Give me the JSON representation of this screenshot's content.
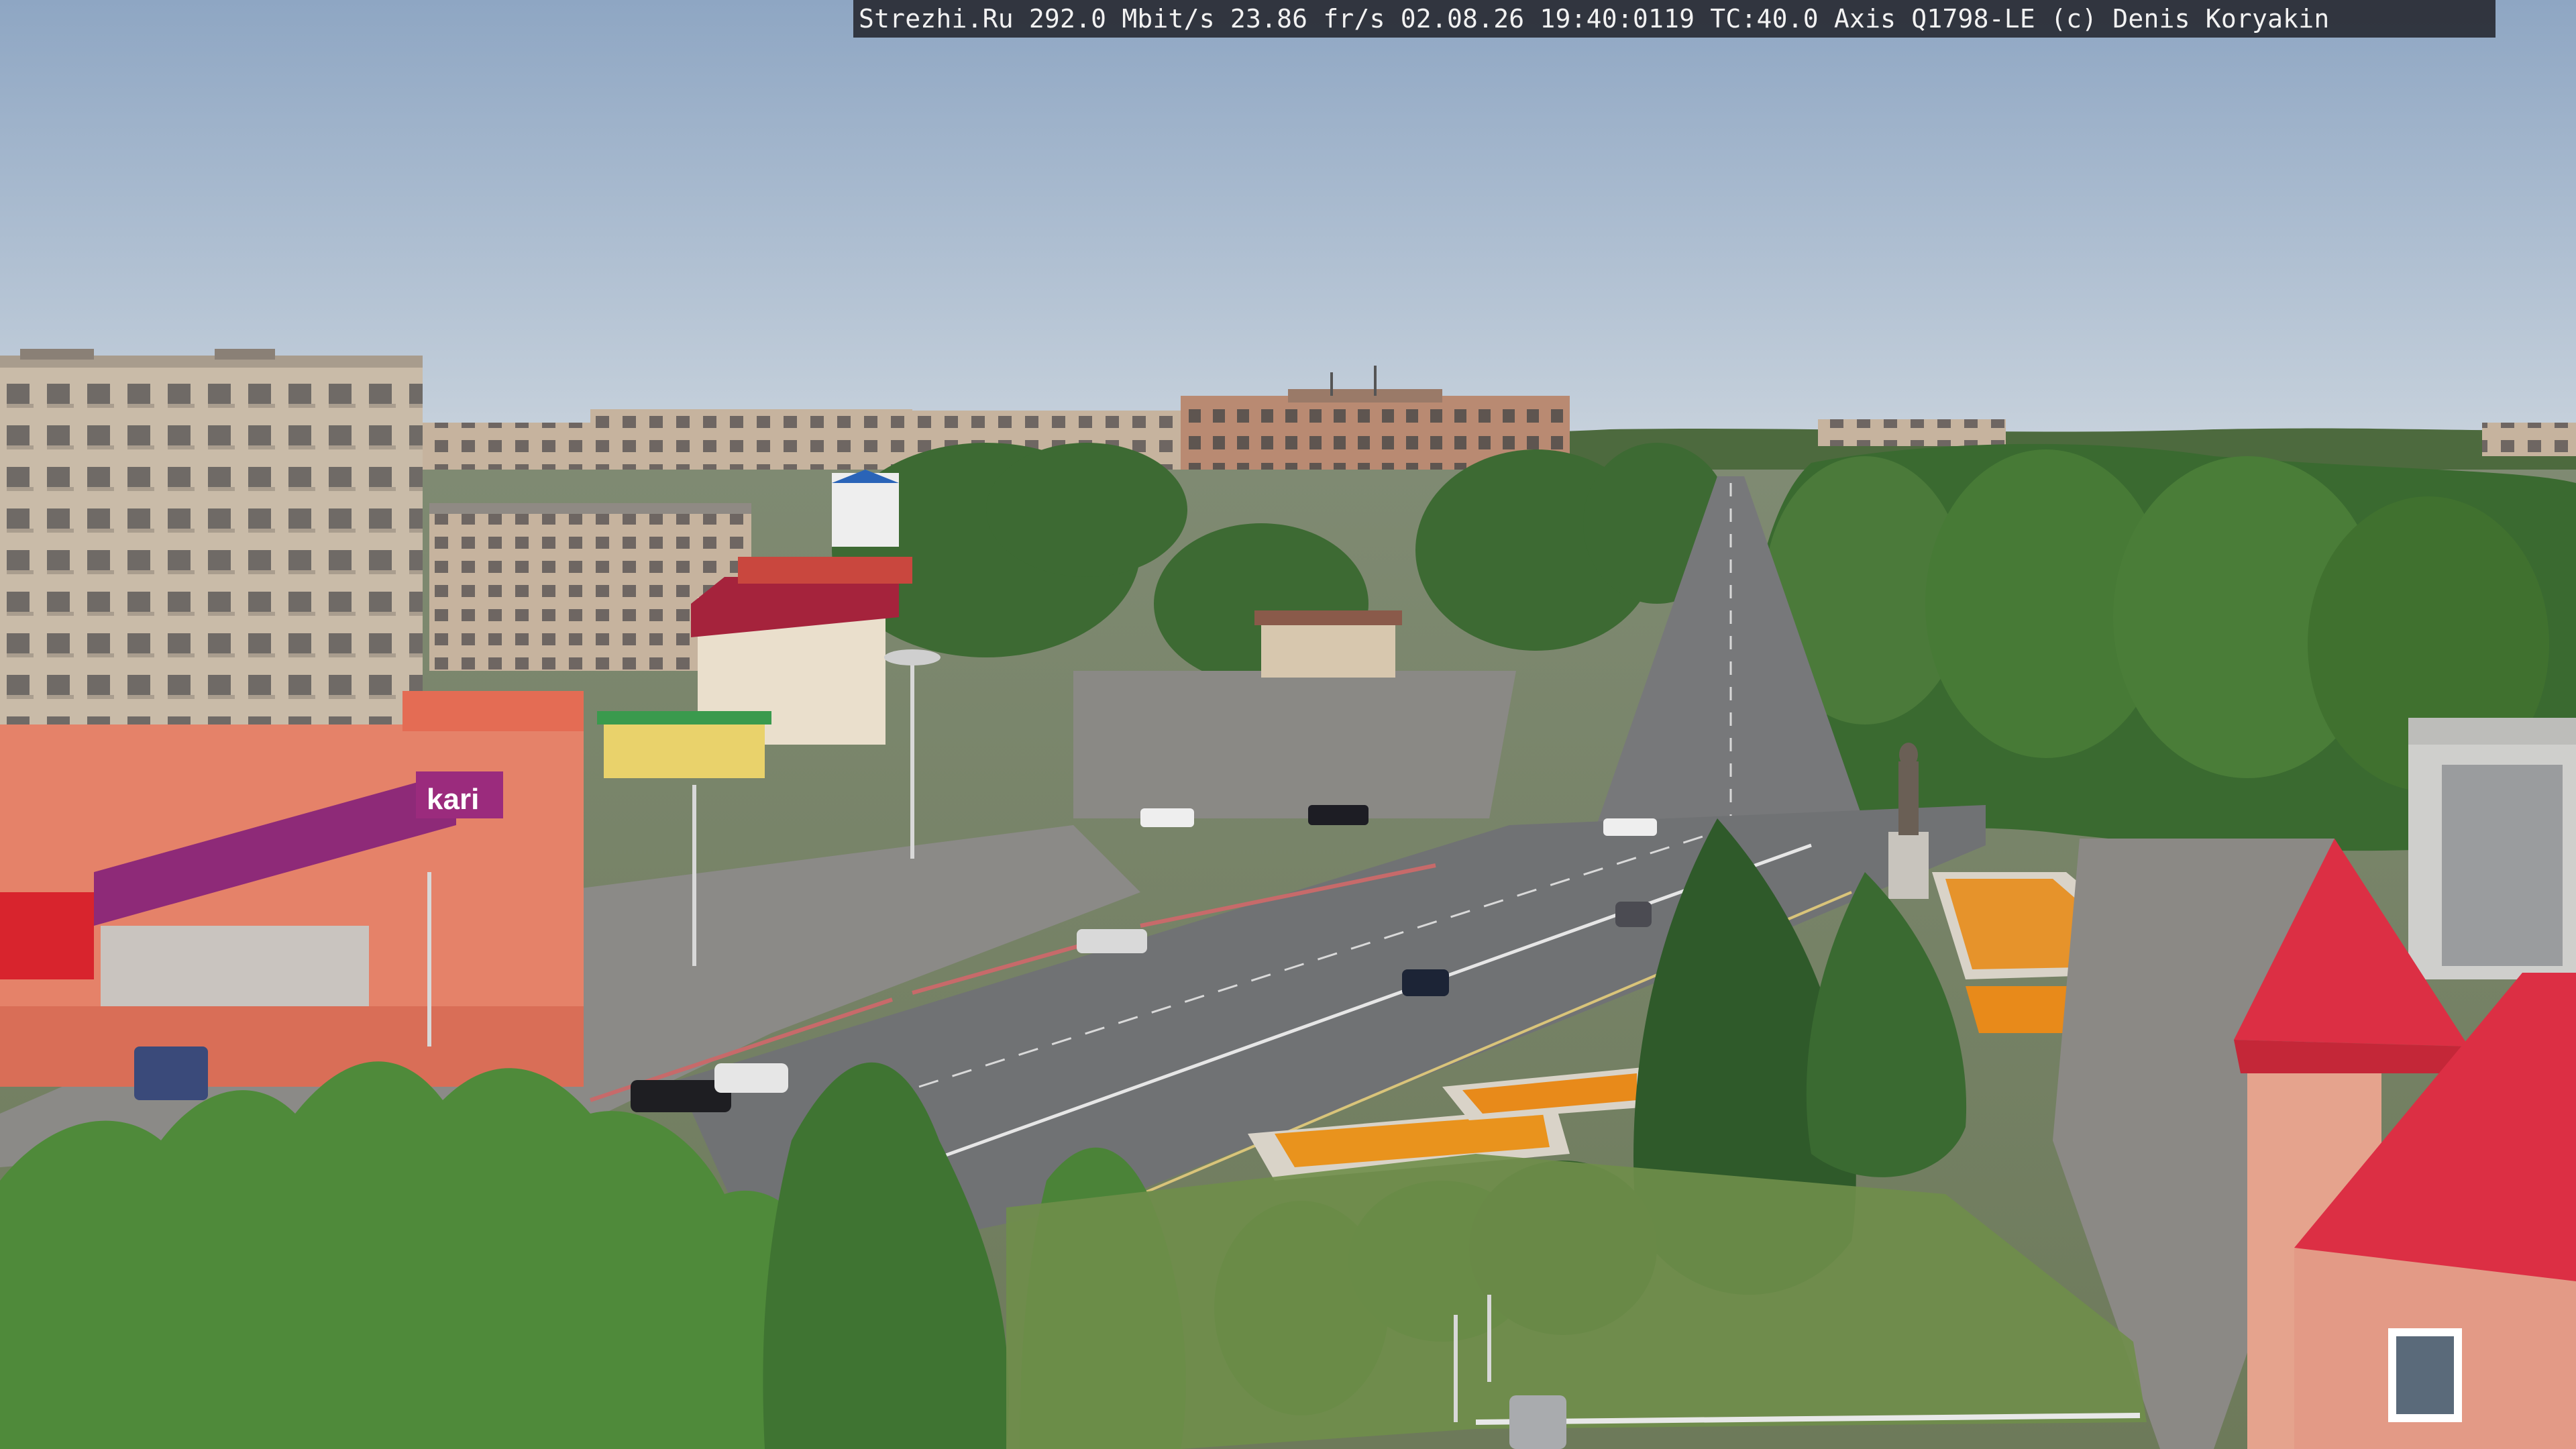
{
  "overlay": {
    "text": "Strezhi.Ru 292.0 Mbit/s 23.86 fr/s 02.08.26 19:40:0119 TC:40.0  Axis Q1798-LE  (c) Denis Koryakin"
  },
  "signs": {
    "store_brand": "kari"
  },
  "colors": {
    "sky_top": "#8fa7c4",
    "sky_bottom": "#c7d2dc",
    "road": "#6f7173",
    "plaza": "#8c8a86",
    "tree_dark": "#2f5a2a",
    "tree_light": "#5f8c3e",
    "building_panel": "#c8b8a6",
    "brick": "#b9876e",
    "store_front": "#e2765a",
    "store_banner": "#8e2a78",
    "roof_red": "#d8303f",
    "flower_orange": "#f08a1a"
  }
}
